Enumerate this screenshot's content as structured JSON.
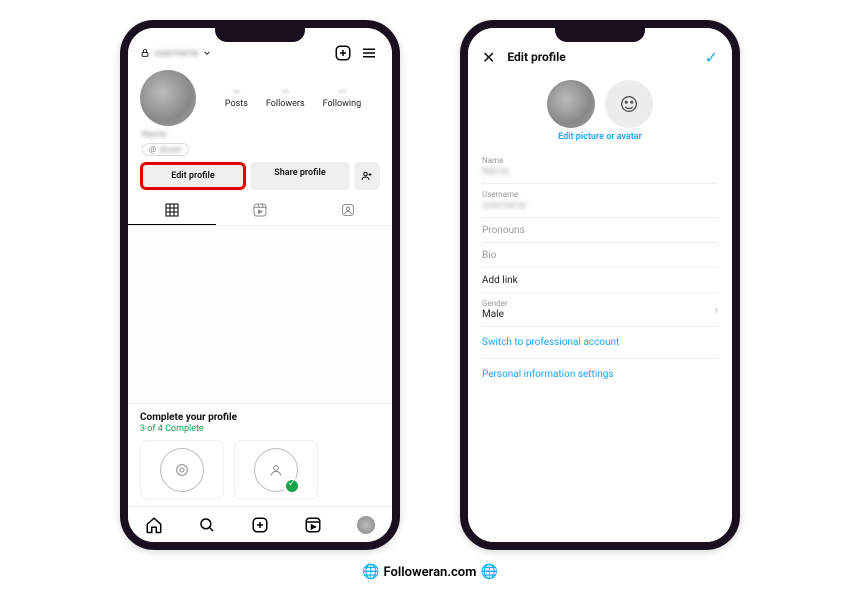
{
  "phone1": {
    "username": "username",
    "stats": {
      "posts": "—",
      "posts_label": "Posts",
      "followers": "—",
      "followers_label": "Followers",
      "following": "—",
      "following_label": "Following"
    },
    "display_name": "Name",
    "threads_handle": "@user",
    "edit_btn": "Edit profile",
    "share_btn": "Share profile",
    "complete_title": "Complete your profile",
    "complete_sub": "3 of 4 Complete"
  },
  "phone2": {
    "title": "Edit profile",
    "link_text": "Edit picture or avatar",
    "name_lbl": "Name",
    "name_val": "Name",
    "user_lbl": "Username",
    "user_val": "username",
    "pron_lbl": "Pronouns",
    "bio_lbl": "Bio",
    "addlink": "Add link",
    "gender_lbl": "Gender",
    "gender_val": "Male",
    "pro_link": "Switch to professional account",
    "info_link": "Personal information settings"
  },
  "footer": "Followeran.com"
}
